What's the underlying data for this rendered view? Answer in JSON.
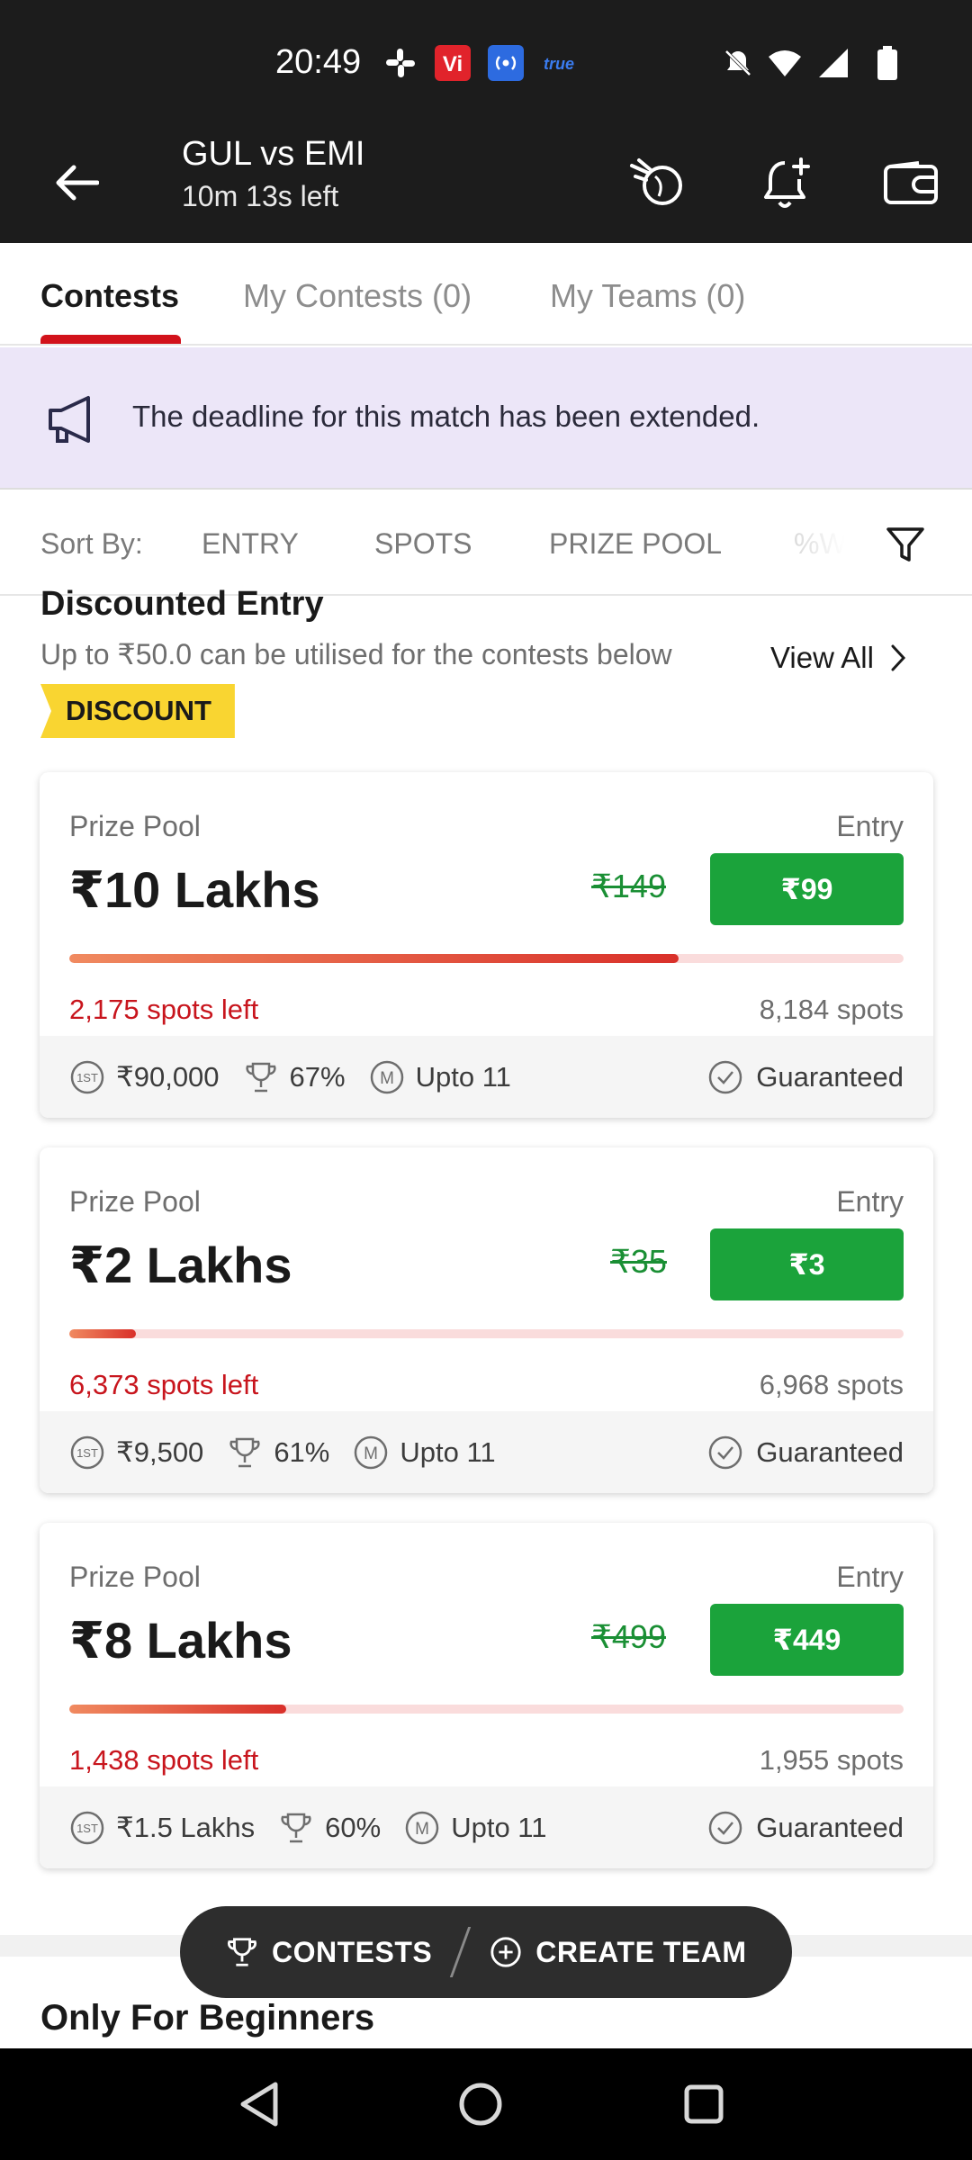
{
  "status_bar": {
    "time": "20:49",
    "carrier_badge": "Vi",
    "true_label": "true",
    "icons": [
      "slack-icon",
      "vi-app-icon",
      "broadcast-icon",
      "true-icon",
      "mute-icon",
      "wifi-icon",
      "signal-icon",
      "battery-icon"
    ]
  },
  "header": {
    "title": "GUL vs EMI",
    "subtitle": "10m 13s left",
    "icons": [
      "back-arrow-icon",
      "guru-ball-icon",
      "add-reminder-bell-icon",
      "wallet-icon"
    ]
  },
  "tabs": [
    {
      "label": "Contests",
      "active": true
    },
    {
      "label": "My Contests (0)",
      "active": false
    },
    {
      "label": "My Teams (0)",
      "active": false
    }
  ],
  "banner": {
    "text": "The deadline for this match has been extended.",
    "icon": "megaphone-icon"
  },
  "sort": {
    "label": "Sort By:",
    "options": [
      "ENTRY",
      "SPOTS",
      "PRIZE POOL",
      "%W"
    ]
  },
  "section": {
    "title": "Discounted Entry",
    "subtitle": "Up to ₹50.0 can be utilised for the contests below",
    "view_all": "View All",
    "tag": "DISCOUNT"
  },
  "contests": [
    {
      "prize_label": "Prize Pool",
      "entry_label": "Entry",
      "prize": "₹10 Lakhs",
      "old_entry": "₹149",
      "entry": "₹99",
      "filled_fraction": 0.73,
      "spots_left": "2,175 spots left",
      "total_spots": "8,184 spots",
      "first_prize": "₹90,000",
      "win_percent": "67%",
      "max_teams": "Upto 11",
      "guaranteed": "Guaranteed"
    },
    {
      "prize_label": "Prize Pool",
      "entry_label": "Entry",
      "prize": "₹2 Lakhs",
      "old_entry": "₹35",
      "entry": "₹3",
      "filled_fraction": 0.08,
      "spots_left": "6,373 spots left",
      "total_spots": "6,968 spots",
      "first_prize": "₹9,500",
      "win_percent": "61%",
      "max_teams": "Upto 11",
      "guaranteed": "Guaranteed"
    },
    {
      "prize_label": "Prize Pool",
      "entry_label": "Entry",
      "prize": "₹8 Lakhs",
      "old_entry": "₹499",
      "entry": "₹449",
      "filled_fraction": 0.26,
      "spots_left": "1,438 spots left",
      "total_spots": "1,955 spots",
      "first_prize": "₹1.5 Lakhs",
      "win_percent": "60%",
      "max_teams": "Upto 11",
      "guaranteed": "Guaranteed"
    }
  ],
  "next_section": {
    "title": "Only For Beginners"
  },
  "action_pill": {
    "contests_label": "CONTESTS",
    "create_team_label": "CREATE TEAM"
  },
  "nav": [
    "back-triangle-icon",
    "home-circle-icon",
    "recents-square-icon"
  ],
  "colors": {
    "header_bg": "#1c1c1c",
    "accent_red": "#d2121b",
    "join_green": "#1ba33b",
    "banner_bg": "#ece6f8",
    "discount_yellow": "#f9d531"
  }
}
